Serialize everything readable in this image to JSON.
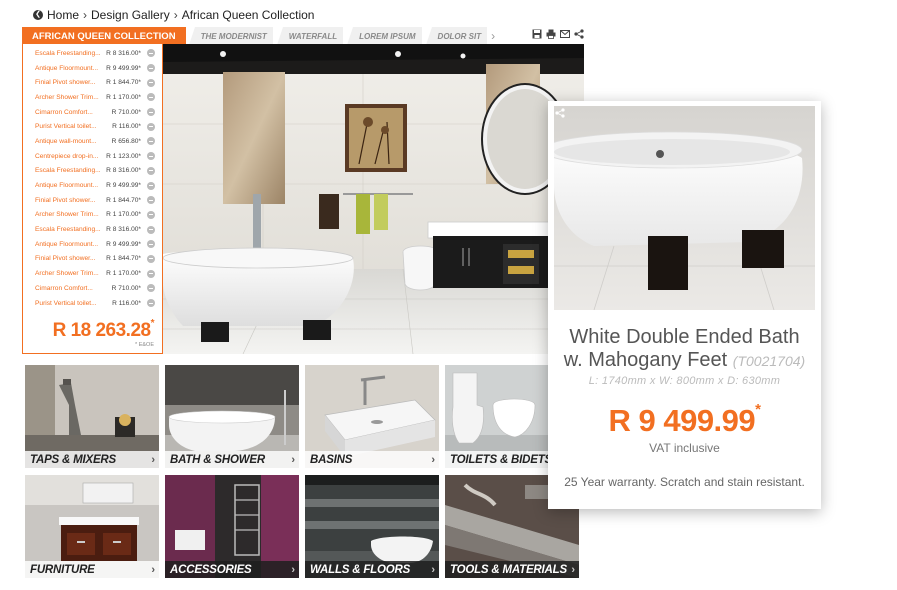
{
  "breadcrumb": {
    "items": [
      "Home",
      "Design Gallery",
      "African Queen Collection"
    ]
  },
  "tabs": {
    "active": "AFRICAN QUEEN COLLECTION",
    "others": [
      "THE MODERNIST",
      "WATERFALL",
      "LOREM IPSUM",
      "DOLOR SIT"
    ]
  },
  "items": [
    {
      "name": "Escala Freestanding...",
      "price": "R 8 316.00*"
    },
    {
      "name": "Antique Floormount...",
      "price": "R 9 499.99*"
    },
    {
      "name": "Finial Pivot shower...",
      "price": "R 1 844.70*"
    },
    {
      "name": "Archer Shower Trim...",
      "price": "R 1 170.00*"
    },
    {
      "name": "Cimarron Comfort...",
      "price": "R 710.00*"
    },
    {
      "name": "Purist Vertical toilet...",
      "price": "R 116.00*"
    },
    {
      "name": "Antique wall-mount...",
      "price": "R 656.80*"
    },
    {
      "name": "Centrepiece drop-in...",
      "price": "R 1 123.00*"
    },
    {
      "name": "Escala Freestanding...",
      "price": "R 8 316.00*"
    },
    {
      "name": "Antique Floormount...",
      "price": "R 9 499.99*"
    },
    {
      "name": "Finial Pivot shower...",
      "price": "R 1 844.70*"
    },
    {
      "name": "Archer Shower Trim...",
      "price": "R 1 170.00*"
    },
    {
      "name": "Escala Freestanding...",
      "price": "R 8 316.00*"
    },
    {
      "name": "Antique Floormount...",
      "price": "R 9 499.99*"
    },
    {
      "name": "Finial Pivot shower...",
      "price": "R 1 844.70*"
    },
    {
      "name": "Archer Shower Trim...",
      "price": "R 1 170.00*"
    },
    {
      "name": "Cimarron Comfort...",
      "price": "R 710.00*"
    },
    {
      "name": "Purist Vertical toilet...",
      "price": "R 116.00*"
    }
  ],
  "total": {
    "value": "R 18 263.28",
    "star": "*",
    "note": "* E&OE"
  },
  "categories": [
    "TAPS & MIXERS",
    "BATH & SHOWER",
    "BASINS",
    "TOILETS & BIDETS",
    "FURNITURE",
    "ACCESSORIES",
    "WALLS & FLOORS",
    "TOOLS & MATERIALS"
  ],
  "product": {
    "title_line1": "White Double Ended Bath",
    "title_line2": "w. Mahogany Feet",
    "code": "(T0021704)",
    "dimensions": "L: 1740mm x W: 800mm x D: 630mm",
    "price": "R 9 499.99",
    "price_star": "*",
    "vat": "VAT inclusive",
    "warranty": "25 Year warranty. Scratch and stain resistant."
  },
  "colors": {
    "accent": "#f26f21"
  },
  "icons": [
    "back-icon",
    "save-icon",
    "print-icon",
    "email-icon",
    "share-icon",
    "remove-icon",
    "chevron-right-icon"
  ]
}
